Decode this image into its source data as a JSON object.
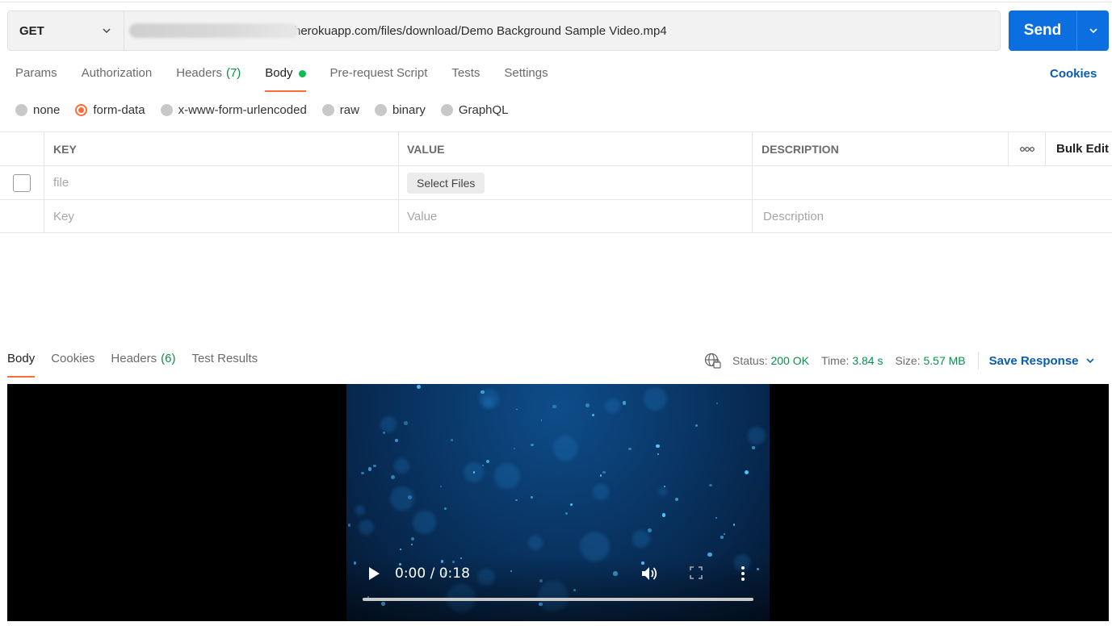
{
  "request": {
    "method": "GET",
    "url": "herokuapp.com/files/download/Demo Background Sample Video.mp4",
    "send_label": "Send"
  },
  "request_tabs": [
    {
      "label": "Params",
      "count": ""
    },
    {
      "label": "Authorization",
      "count": ""
    },
    {
      "label": "Headers",
      "count": "(7)"
    },
    {
      "label": "Body",
      "count": "",
      "active": true
    },
    {
      "label": "Pre-request Script",
      "count": ""
    },
    {
      "label": "Tests",
      "count": ""
    },
    {
      "label": "Settings",
      "count": ""
    }
  ],
  "cookies_link": "Cookies",
  "body_modes": [
    "none",
    "form-data",
    "x-www-form-urlencoded",
    "raw",
    "binary",
    "GraphQL"
  ],
  "selected_body_mode": "form-data",
  "table": {
    "headers": {
      "key": "KEY",
      "value": "VALUE",
      "description": "DESCRIPTION",
      "bulk_edit": "Bulk Edit"
    },
    "row1": {
      "key_placeholder": "file",
      "value_button": "Select Files"
    },
    "row2": {
      "key_placeholder": "Key",
      "value_placeholder": "Value",
      "description_placeholder": "Description"
    }
  },
  "response_tabs": [
    {
      "label": "Body",
      "count": "",
      "active": true
    },
    {
      "label": "Cookies",
      "count": ""
    },
    {
      "label": "Headers",
      "count": "(6)"
    },
    {
      "label": "Test Results",
      "count": ""
    }
  ],
  "response": {
    "status_label": "Status:",
    "status_value": "200 OK",
    "time_label": "Time:",
    "time_value": "3.84 s",
    "size_label": "Size:",
    "size_value": "5.57 MB",
    "save_label": "Save Response"
  },
  "video": {
    "time": "0:00 / 0:18",
    "progress": 0
  },
  "colors": {
    "accent": "#ff6c37",
    "send": "#0b6fe0",
    "link": "#0b5cad",
    "success": "#0a8f4a"
  }
}
